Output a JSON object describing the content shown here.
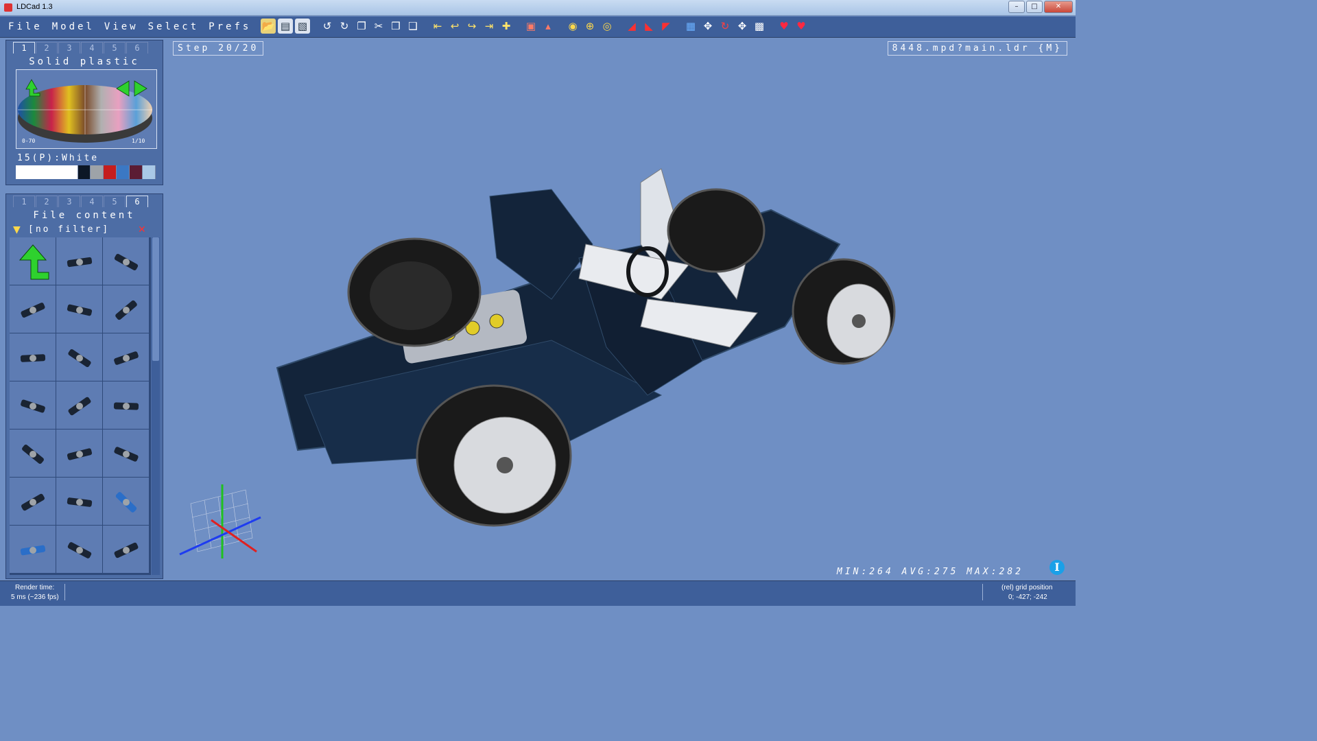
{
  "window": {
    "title": "LDCad 1.3"
  },
  "menu": [
    "File",
    "Model",
    "View",
    "Select",
    "Prefs"
  ],
  "toolbar_icons": [
    "open-icon",
    "save-icon",
    "save-all-icon",
    "undo-icon",
    "redo-icon",
    "copy-icon",
    "cut-icon",
    "paste-icon",
    "paste-special-icon",
    "first-step-icon",
    "prev-step-icon",
    "next-step-icon",
    "last-step-icon",
    "add-step-icon",
    "group-icon",
    "ungroup-icon",
    "color-icon",
    "snap-icon",
    "grid-icon",
    "hide-icon",
    "unhide-icon",
    "clip-icon",
    "rotate-mode-icon",
    "move-icon",
    "rotate-icon",
    "pan-icon",
    "select-area-icon",
    "favorite-icon",
    "favorite-add-icon"
  ],
  "color_panel": {
    "tabs": [
      "1",
      "2",
      "3",
      "4",
      "5",
      "6"
    ],
    "active_tab": "1",
    "title": "Solid plastic",
    "range_label": "0-70",
    "page_label": "1/10",
    "selected_color": "15(P):White",
    "recent_colors": [
      "#ffffff",
      "#0c1726",
      "#9ea3a8",
      "#c51d1d",
      "#3b78c4",
      "#5b1c34",
      "#a9c8e6"
    ]
  },
  "file_panel": {
    "tabs": [
      "1",
      "2",
      "3",
      "4",
      "5",
      "6"
    ],
    "active_tab": "6",
    "title": "File content",
    "filter": "[no filter]"
  },
  "viewport": {
    "step": "Step 20/20",
    "model": "8448.mpd?main.ldr {M}",
    "stats": "MIN:264 AVG:275 MAX:282"
  },
  "status": {
    "render_label": "Render time:",
    "render_value": "5 ms (~236 fps)",
    "grid_label": "(rel) grid position",
    "grid_value": "0; -427; -242"
  },
  "colors": {
    "background": "#6f8fc4",
    "panel": "#4d6da5",
    "bar": "#3e5f9a"
  }
}
